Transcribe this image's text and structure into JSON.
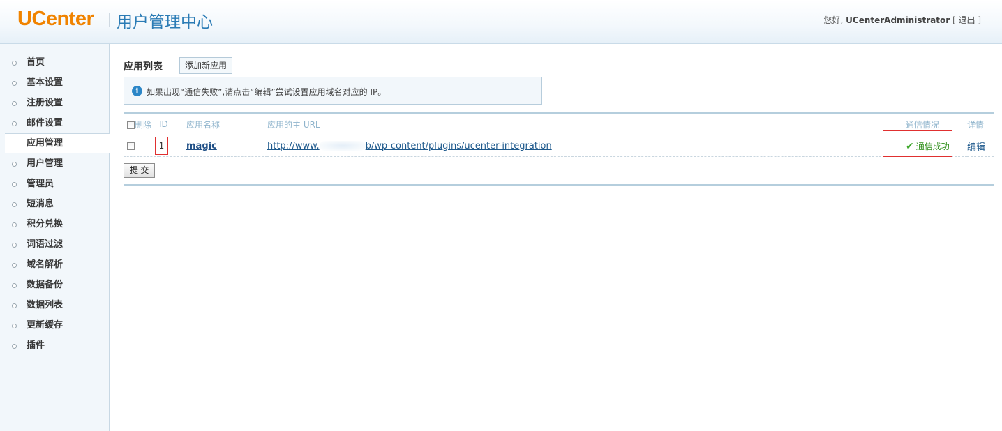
{
  "header": {
    "logo": "UCenter",
    "title": "用户管理中心",
    "greeting": "您好,",
    "username": "UCenterAdministrator",
    "bracket_open": "[",
    "logout": "退出",
    "bracket_close": "]"
  },
  "sidebar": {
    "items": [
      {
        "label": "首页"
      },
      {
        "label": "基本设置"
      },
      {
        "label": "注册设置"
      },
      {
        "label": "邮件设置"
      },
      {
        "label": "应用管理",
        "active": true
      },
      {
        "label": "用户管理"
      },
      {
        "label": "管理员"
      },
      {
        "label": "短消息"
      },
      {
        "label": "积分兑换"
      },
      {
        "label": "词语过滤"
      },
      {
        "label": "域名解析"
      },
      {
        "label": "数据备份"
      },
      {
        "label": "数据列表"
      },
      {
        "label": "更新缓存"
      },
      {
        "label": "插件"
      }
    ]
  },
  "main": {
    "list_title": "应用列表",
    "add_button": "添加新应用",
    "notice": "如果出现“通信失败”,请点击“编辑”尝试设置应用域名对应的 IP。",
    "table": {
      "headers": {
        "delete": "删除",
        "id": "ID",
        "name": "应用名称",
        "url": "应用的主 URL",
        "status": "通信情况",
        "detail": "详情"
      },
      "rows": [
        {
          "id": "1",
          "name": "magic",
          "url_prefix": "http://www.",
          "url_suffix": "b/wp-content/plugins/ucenter-integration",
          "status": "通信成功",
          "detail": "编辑"
        }
      ]
    },
    "submit": "提 交"
  },
  "colors": {
    "logo": "#f08300",
    "title": "#2a7bb5",
    "status_ok": "#2f8f1a",
    "highlight_box": "#e03030"
  }
}
